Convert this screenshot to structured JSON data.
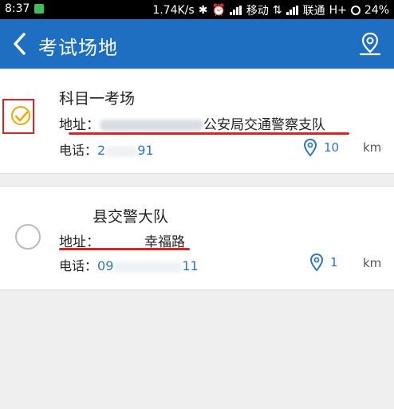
{
  "status_bar": {
    "time": "8:37",
    "speed": "1.74K/s",
    "carrier1": "移动",
    "carrier2": "联通",
    "network": "H+",
    "battery": "24%"
  },
  "app_bar": {
    "title": "考试场地",
    "back_icon": "chevron-left-icon",
    "map_icon": "map-pin-icon"
  },
  "venues": [
    {
      "name": "科目一考场",
      "address_label": "地址：",
      "address_suffix": "公安局交通警察支队",
      "phone_label": "电话：",
      "phone_start": "2",
      "phone_end": "91",
      "distance": "10",
      "unit": "km",
      "selected": true
    },
    {
      "name": "县交警大队",
      "address_label": "地址：",
      "address_suffix": "幸福路",
      "phone_label": "电话：",
      "phone_start": "09",
      "phone_end": "11",
      "distance": "1",
      "unit": "km",
      "selected": false
    }
  ],
  "colors": {
    "app_bar": "#1e6fc2",
    "accent_check": "#f2a800",
    "annotation_red": "#d42626",
    "link_blue": "#2d77c0"
  }
}
